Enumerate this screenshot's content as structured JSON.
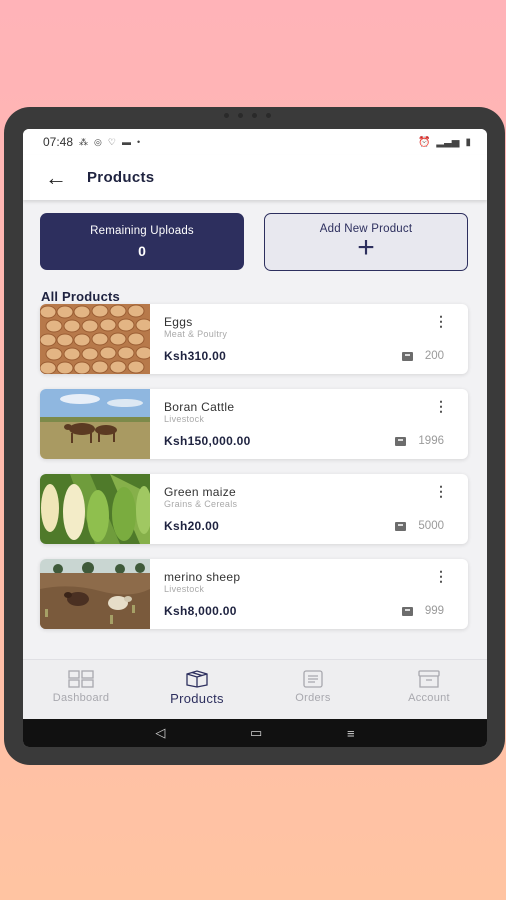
{
  "status_bar": {
    "time": "07:48",
    "left_icons": [
      "notification-icon",
      "alarm-icon",
      "shield-icon",
      "message-icon"
    ],
    "right_icons": [
      "alarm-clock-icon",
      "signal-icon",
      "battery-icon"
    ]
  },
  "header": {
    "title": "Products",
    "back_icon": "arrow-left-icon"
  },
  "summary": {
    "remaining_label": "Remaining Uploads",
    "remaining_value": "0",
    "add_label": "Add New Product",
    "add_icon": "plus-icon"
  },
  "section_title": "All Products",
  "products": [
    {
      "name": "Eggs",
      "category": "Meat & Poultry",
      "price": "Ksh310.00",
      "stock": "200",
      "image": "eggs"
    },
    {
      "name": "Boran Cattle",
      "category": "Livestock",
      "price": "Ksh150,000.00",
      "stock": "1996",
      "image": "cattle"
    },
    {
      "name": "Green maize",
      "category": "Grains & Cereals",
      "price": "Ksh20.00",
      "stock": "5000",
      "image": "maize"
    },
    {
      "name": "merino sheep",
      "category": "Livestock",
      "price": "Ksh8,000.00",
      "stock": "999",
      "image": "sheep"
    }
  ],
  "bottom_nav": [
    {
      "label": "Dashboard",
      "icon": "dashboard-icon",
      "active": false
    },
    {
      "label": "Products",
      "icon": "box-icon",
      "active": true
    },
    {
      "label": "Orders",
      "icon": "orders-icon",
      "active": false
    },
    {
      "label": "Account",
      "icon": "account-icon",
      "active": false
    }
  ],
  "colors": {
    "primary": "#2d2f5e",
    "background": "#f2f2f4",
    "muted": "#a8a8ae"
  }
}
